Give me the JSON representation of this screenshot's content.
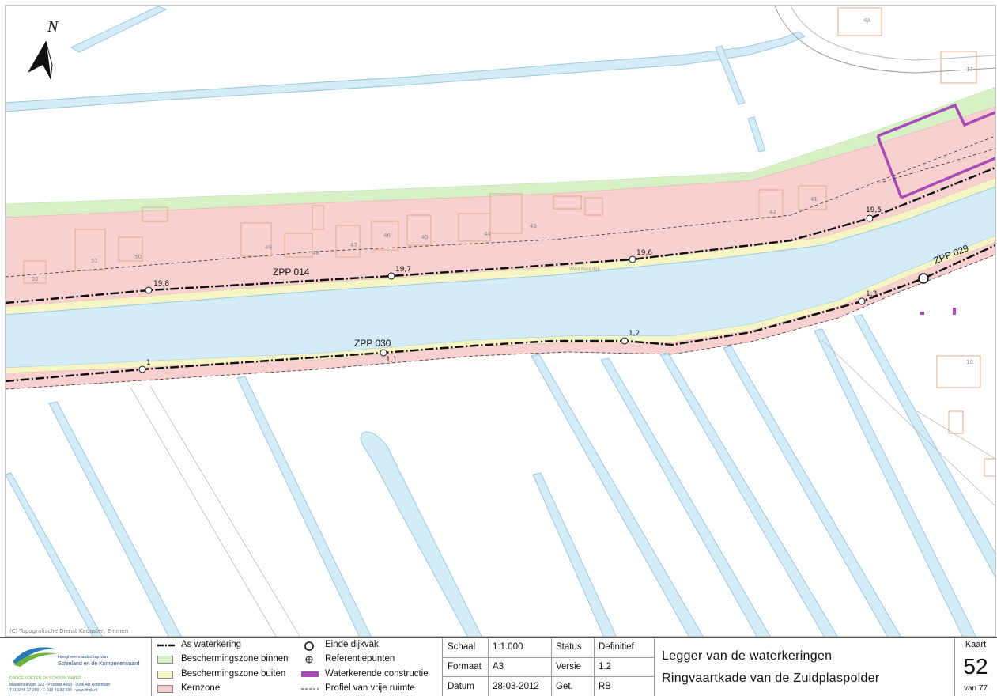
{
  "map": {
    "north_label": "N",
    "copyright": "(C) Topografische Dienst Kadaster, Emmen",
    "road_label": "Wed Ringdijk",
    "segments": [
      {
        "id": "zpp014",
        "label": "ZPP 014"
      },
      {
        "id": "zpp030",
        "label": "ZPP 030"
      },
      {
        "id": "zpp029",
        "label": "ZPP 029"
      }
    ],
    "reference_points": [
      "19,8",
      "19,7",
      "19,6",
      "19,5",
      "1",
      "1,1",
      "1,2",
      "1,3"
    ],
    "house_numbers": [
      "52",
      "51",
      "50",
      "49",
      "48",
      "47",
      "46",
      "45",
      "44",
      "43",
      "42",
      "41",
      "4A",
      "17",
      "10"
    ],
    "colors": {
      "water": "#d3ecf7",
      "water_edge": "#9cc7db",
      "buffer_inner": "#d8f0c8",
      "buffer_outer": "#f5f5c6",
      "core_zone": "#f8d0d0",
      "construction": "#a64bb5",
      "buildings": "#e0a889"
    }
  },
  "legend": {
    "org": {
      "name_line1": "Hoogheemraadschap van",
      "name_line2": "Schieland en de Krimpenerwaard",
      "slogan": "DROGE VOETEN EN SCHOON WATER",
      "address": "Maasboulevard 123 - Postbus 4059 - 3006 AB Rotterdam",
      "contact": "T. 010 45 37 200 - F. 010 41 30 694 - www.hhsk.nl"
    },
    "items_left": [
      {
        "label": "As waterkering"
      },
      {
        "label": "Beschermingszone binnen"
      },
      {
        "label": "Beschermingszone buiten"
      },
      {
        "label": "Kernzone"
      }
    ],
    "items_right": [
      {
        "label": "Einde dijkvak"
      },
      {
        "label": "Referentiepunten"
      },
      {
        "label": "Waterkerende constructie"
      },
      {
        "label": "Profiel van vrije ruimte"
      }
    ],
    "meta": {
      "schaal_label": "Schaal",
      "schaal_value": "1:1.000",
      "status_label": "Status",
      "status_value": "Definitief",
      "formaat_label": "Formaat",
      "formaat_value": "A3",
      "versie_label": "Versie",
      "versie_value": "1.2",
      "datum_label": "Datum",
      "datum_value": "28-03-2012",
      "get_label": "Get.",
      "get_value": "RB"
    },
    "title_line1": "Legger van de waterkeringen",
    "title_line2": "Ringvaartkade van de Zuidplaspolder",
    "kaart_label": "Kaart",
    "kaart_number": "52",
    "kaart_total": "van 77"
  }
}
